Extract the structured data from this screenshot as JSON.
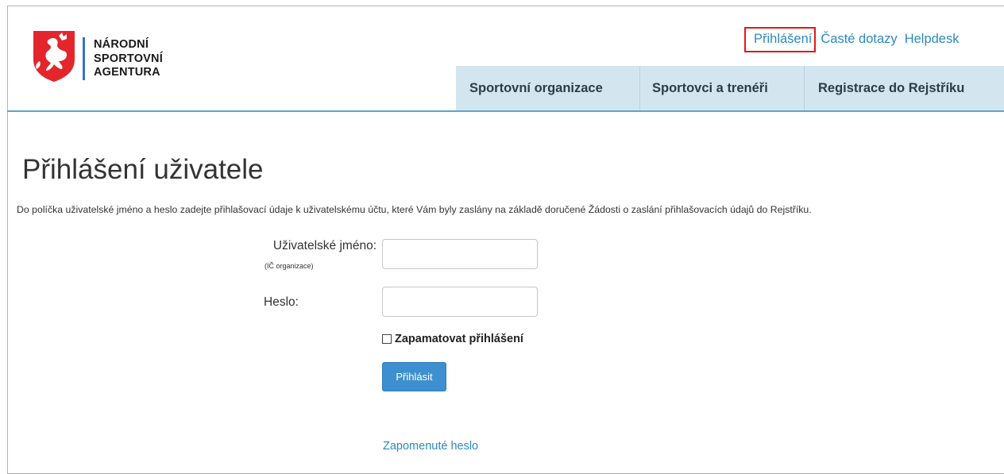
{
  "brand": {
    "line1": "NÁRODNÍ",
    "line2": "SPORTOVNÍ",
    "line3": "AGENTURA",
    "logo_icon": "czech-lion-shield-icon",
    "shield_color": "#e3262c"
  },
  "top_links": {
    "login": "Přihlášení",
    "faq": "Časté dotazy",
    "helpdesk": "Helpdesk"
  },
  "nav": {
    "items": [
      {
        "label": "Sportovní organizace"
      },
      {
        "label": "Sportovci a trenéři"
      },
      {
        "label": "Registrace do Rejstříku"
      }
    ]
  },
  "page": {
    "title": "Přihlášení uživatele",
    "intro": "Do políčka uživatelské jméno a heslo zadejte přihlašovací údaje k uživatelskému účtu, které Vám byly zaslány na základě doručené Žádosti o zaslání přihlašovacích údajů do Rejstříku."
  },
  "form": {
    "username_label": "Uživatelské jméno:",
    "username_sublabel": "(IČ organizace)",
    "username_value": "",
    "password_label": "Heslo:",
    "password_value": "",
    "remember_label": "Zapamatovat přihlášení",
    "remember_checked": false,
    "submit_label": "Přihlásit",
    "forgot_label": "Zapomenuté heslo"
  },
  "colors": {
    "link": "#2b8ac4",
    "nav_bg": "#d3e6ef",
    "button": "#3d8fcf",
    "highlight_border": "#e01a1a"
  }
}
